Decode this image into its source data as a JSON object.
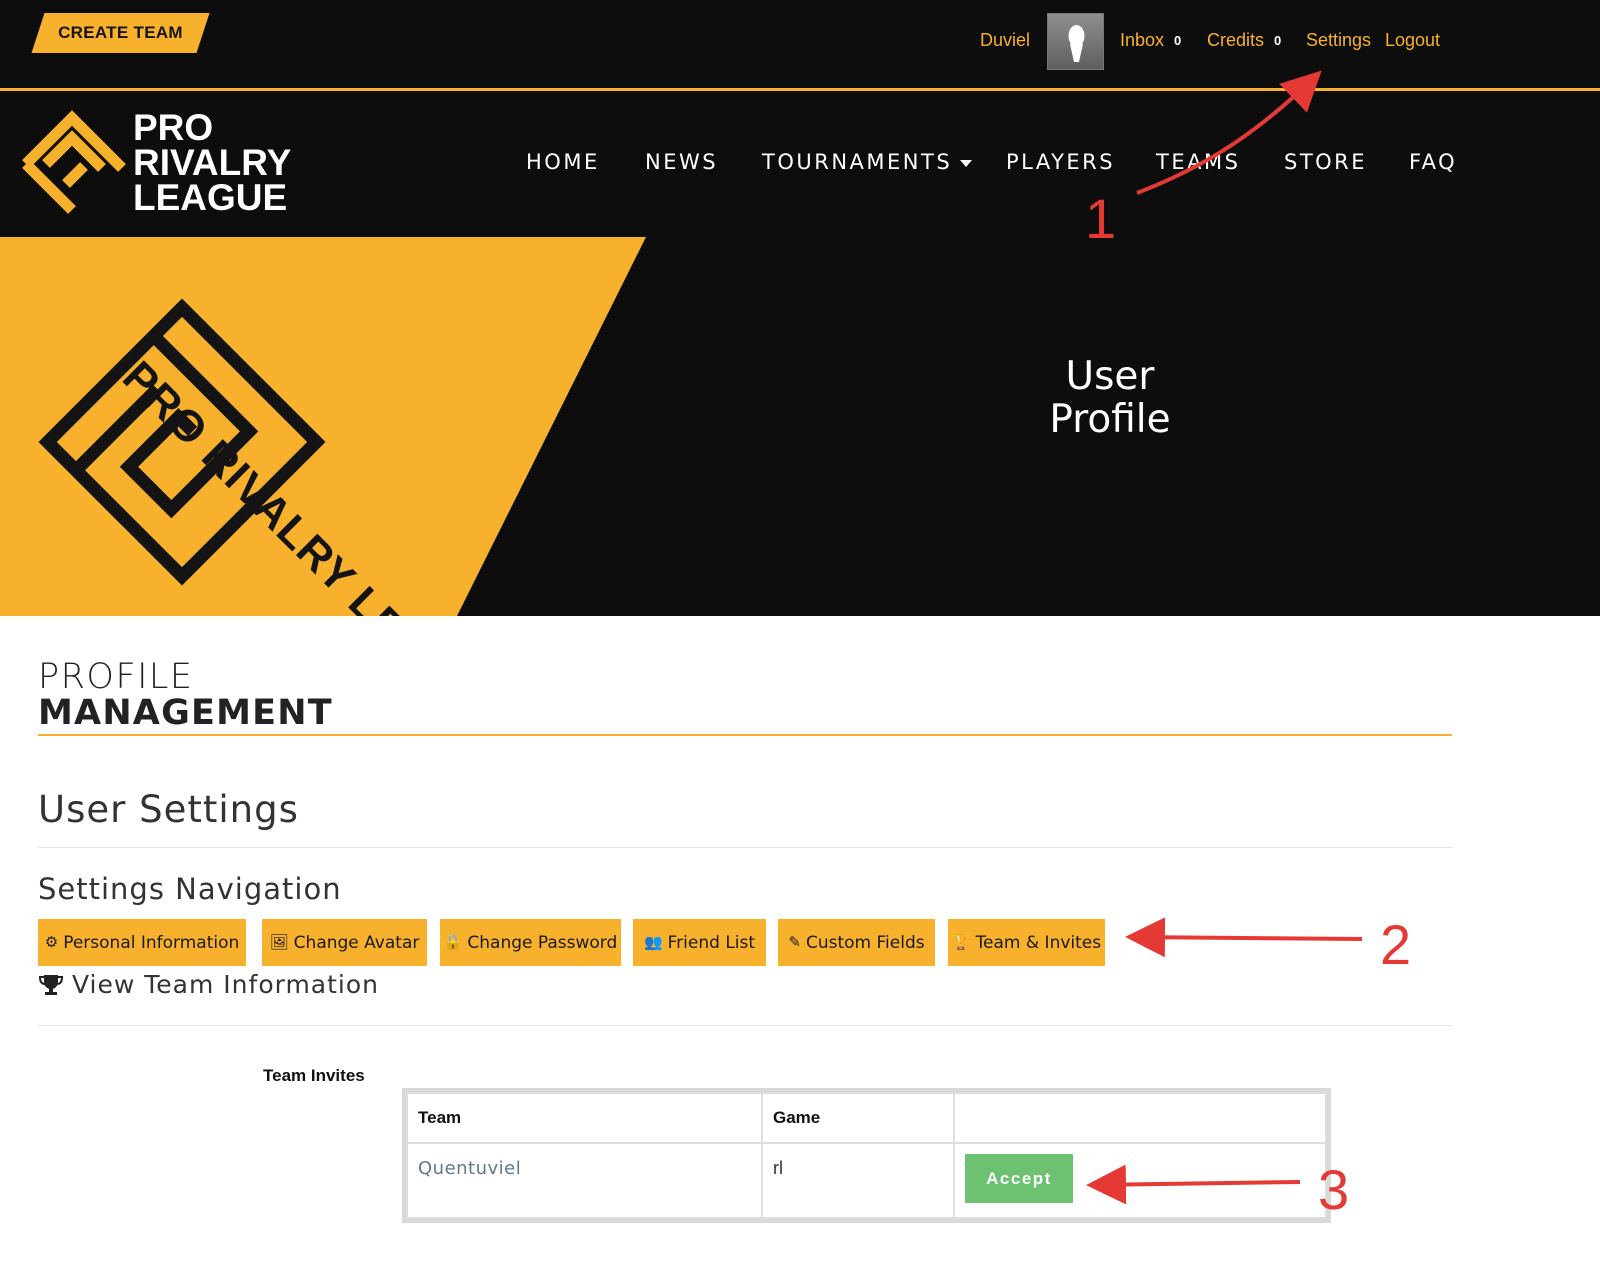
{
  "topbar": {
    "create_team_label": "CREATE TEAM",
    "username": "Duviel",
    "inbox_label": "Inbox",
    "inbox_count": "0",
    "credits_label": "Credits",
    "credits_count": "0",
    "settings_label": "Settings",
    "logout_label": "Logout"
  },
  "brand": {
    "line1": "PRO",
    "line2": "RIVALRY",
    "line3": "LEAGUE",
    "hero_logo_text": "PRO RIVALRY LEAGUE"
  },
  "nav": {
    "items": [
      "HOME",
      "NEWS",
      "TOURNAMENTS",
      "PLAYERS",
      "TEAMS",
      "STORE",
      "FAQ"
    ]
  },
  "hero": {
    "title_line1": "User",
    "title_line2": "Profile"
  },
  "content": {
    "heading_light": "PROFILE",
    "heading_bold": "MANAGEMENT",
    "section_title": "User Settings",
    "subsection_title": "Settings Navigation",
    "buttons": [
      {
        "label": "Personal Information",
        "icon": "gear-icon"
      },
      {
        "label": "Change Avatar",
        "icon": "picture-icon"
      },
      {
        "label": "Change Password",
        "icon": "lock-icon"
      },
      {
        "label": "Friend List",
        "icon": "users-icon"
      },
      {
        "label": "Custom Fields",
        "icon": "pencil-icon"
      },
      {
        "label": "Team & Invites",
        "icon": "trophy-icon"
      }
    ],
    "view_team_label": "View Team Information",
    "team_invites_label": "Team Invites",
    "table": {
      "headers": [
        "Team",
        "Game",
        ""
      ],
      "rows": [
        {
          "team": "Quentuviel",
          "game": "rl",
          "action": "Accept"
        }
      ]
    }
  },
  "annotations": [
    "1",
    "2",
    "3"
  ],
  "colors": {
    "accent": "#f8b12c",
    "background_dark": "#0d0d0d",
    "accept_green": "#6cc270",
    "annotation_red": "#e53935"
  }
}
